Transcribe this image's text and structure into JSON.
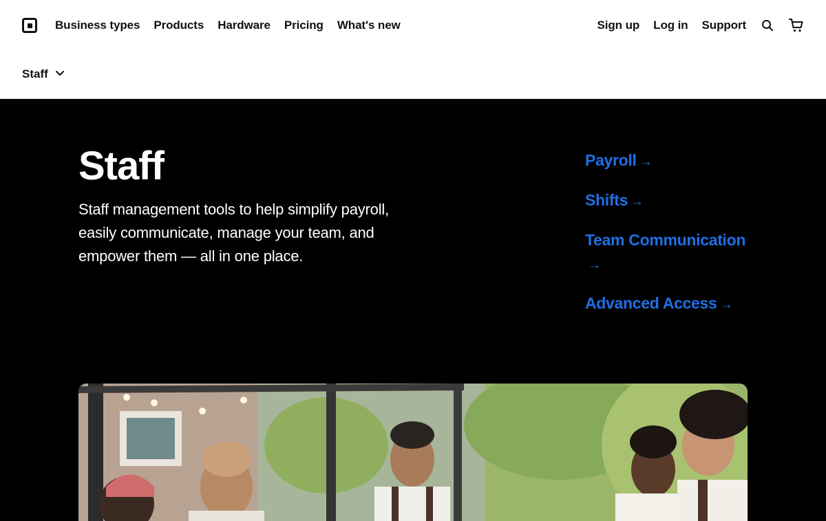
{
  "header": {
    "nav_left": [
      "Business types",
      "Products",
      "Hardware",
      "Pricing",
      "What's new"
    ],
    "nav_right": [
      "Sign up",
      "Log in",
      "Support"
    ],
    "icons": [
      "search-icon",
      "cart-icon"
    ]
  },
  "subnav": {
    "label": "Staff"
  },
  "hero": {
    "title": "Staff",
    "description": "Staff management tools to help simplify payroll, easily communicate, manage your team, and empower them — all in one place.",
    "links": [
      "Payroll",
      "Shifts",
      "Team Communication",
      "Advanced Access"
    ]
  },
  "colors": {
    "link": "#1f6fe5",
    "hero_bg": "#000000"
  }
}
